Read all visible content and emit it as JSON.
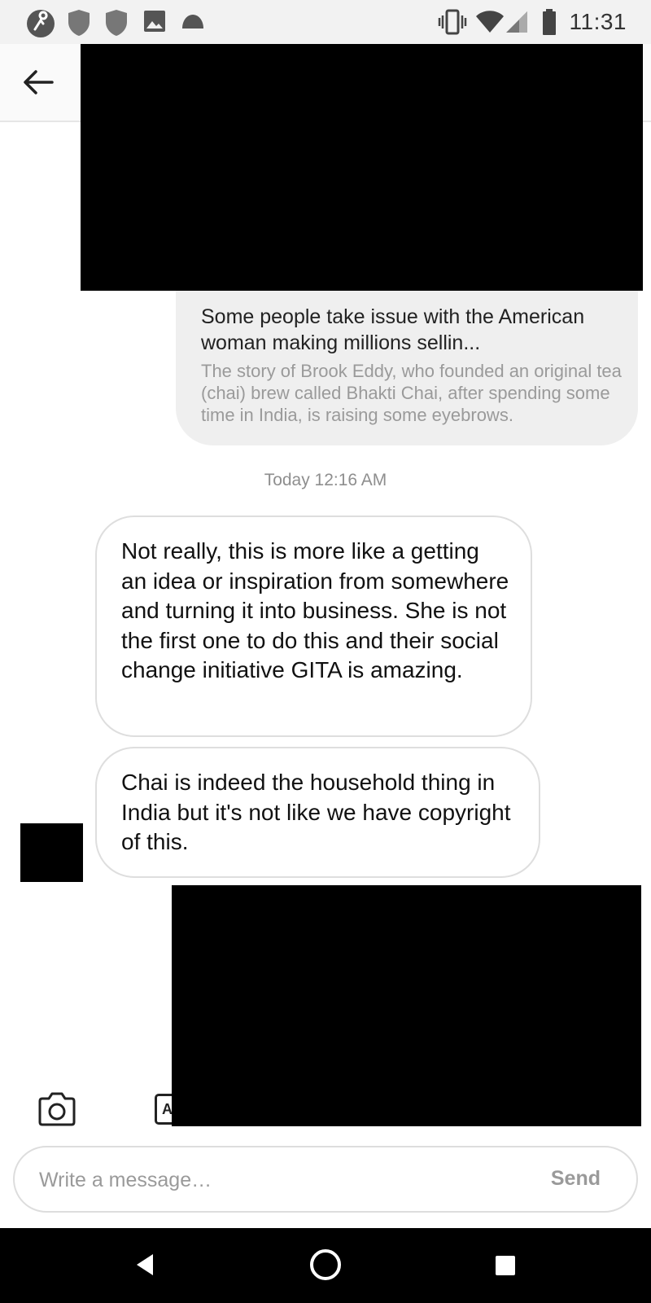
{
  "status_bar": {
    "time": "11:31",
    "left_icons": [
      "app-notification-icon",
      "shield-icon",
      "shield-icon",
      "image-icon",
      "cloud-icon"
    ],
    "right_icons": [
      "vibrate-icon",
      "wifi-icon",
      "signal-icon",
      "battery-icon"
    ]
  },
  "header": {
    "back_icon": "arrow-left-icon"
  },
  "link_preview": {
    "title": "Some people take issue with the American woman making millions sellin...",
    "description": "The story of Brook Eddy, who founded an original tea (chai) brew called Bhakti Chai, after spending some time in India, is raising some eyebrows."
  },
  "timestamp": "Today 12:16 AM",
  "messages": [
    {
      "text": "Not really, this is more like a getting an idea or inspiration from somewhere and turning it into business. She is not the first one to do this and their social change initiative GITA is amazing."
    },
    {
      "text": "Chai is indeed the household thing in India but it's not like we have copyright of this."
    }
  ],
  "composer": {
    "camera_icon": "camera-icon",
    "text_tool_label": "A",
    "placeholder": "Write a message…",
    "send_label": "Send"
  },
  "nav_bar": {
    "icons": [
      "back-triangle-icon",
      "home-circle-icon",
      "recents-square-icon"
    ]
  },
  "colors": {
    "bubble_border": "#dedede",
    "link_card_bg": "#efefef",
    "muted_text": "#9a9a9a",
    "nav_bg": "#000000"
  }
}
